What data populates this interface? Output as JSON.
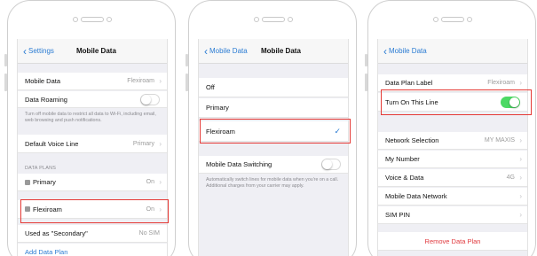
{
  "colors": {
    "accent": "#2b7cd3",
    "highlight": "#e53935",
    "toggle_on": "#4cd964",
    "destructive": "#e0393e"
  },
  "phone1": {
    "back_label": "Settings",
    "title": "Mobile Data",
    "mobile_data": {
      "label": "Mobile Data",
      "value": "Flexiroam"
    },
    "data_roaming": {
      "label": "Data Roaming",
      "on": false
    },
    "roaming_note": "Turn off mobile data to restrict all data to Wi-Fi, including email, web browsing and push notifications.",
    "default_voice": {
      "label": "Default Voice Line",
      "value": "Primary"
    },
    "data_plans_header": "DATA PLANS",
    "plans": [
      {
        "label": "Primary",
        "value": "On"
      },
      {
        "label": "Flexiroam",
        "value": "On"
      }
    ],
    "used_as": {
      "label": "Used as \"Secondary\"",
      "value": "No SIM"
    },
    "add_plan": "Add Data Plan"
  },
  "phone2": {
    "back_label": "Mobile Data",
    "title": "Mobile Data",
    "options": [
      "Off",
      "Primary"
    ],
    "selected_option": "Flexiroam",
    "switching": {
      "label": "Mobile Data Switching",
      "on": false
    },
    "switching_note": "Automatically switch lines for mobile data when you're on a call. Additional charges from your carrier may apply."
  },
  "phone3": {
    "back_label": "Mobile Data",
    "plan_label": {
      "label": "Data Plan Label",
      "value": "Flexiroam"
    },
    "turn_on": {
      "label": "Turn On This Line",
      "on": true
    },
    "network_selection": {
      "label": "Network Selection",
      "value": "MY MAXIS"
    },
    "my_number": {
      "label": "My Number"
    },
    "voice_data": {
      "label": "Voice & Data",
      "value": "4G"
    },
    "mobile_data_network": {
      "label": "Mobile Data Network"
    },
    "sim_pin": {
      "label": "SIM PIN"
    },
    "remove_plan": "Remove Data Plan"
  }
}
